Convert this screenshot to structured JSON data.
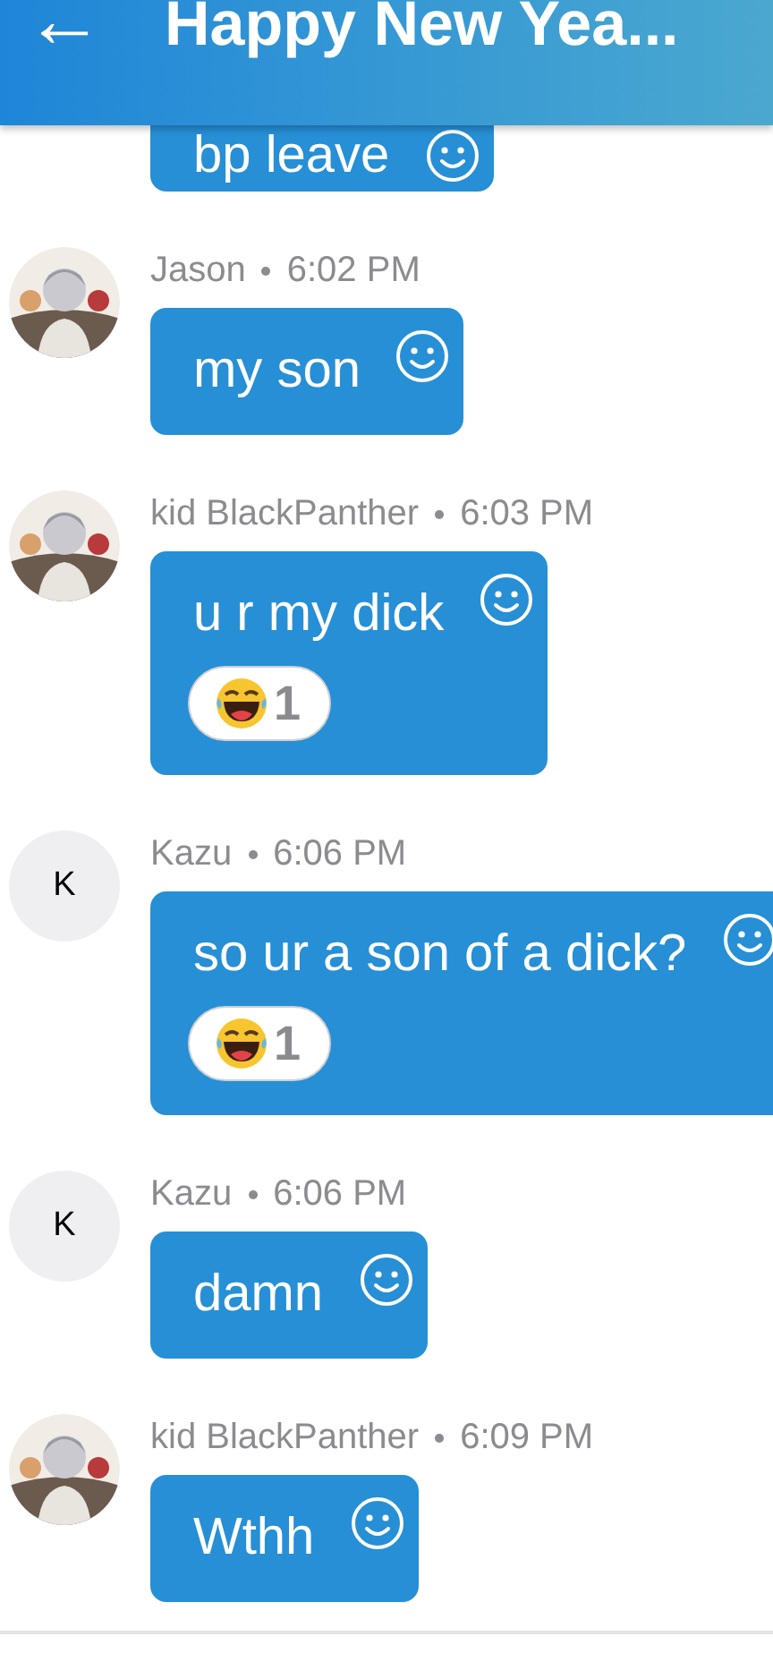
{
  "header": {
    "back": "←",
    "title": "Happy New Yea..."
  },
  "messages": [
    {
      "text": "bp leave"
    },
    {
      "sender": "Jason",
      "time": "6:02 PM",
      "text": "my son"
    },
    {
      "sender": "kid BlackPanther",
      "time": "6:03 PM",
      "text": "u r my dick",
      "reactions": [
        {
          "count": "1"
        }
      ]
    },
    {
      "avatar": {
        "kind": "initial",
        "initial": "K"
      },
      "sender": "Kazu",
      "time": "6:06 PM",
      "text": "so ur a son of a dick?",
      "reactions": [
        {
          "count": "1"
        }
      ]
    },
    {
      "avatar": {
        "kind": "initial",
        "initial": "K"
      },
      "sender": "Kazu",
      "time": "6:06 PM",
      "text": "damn"
    },
    {
      "sender": "kid BlackPanther",
      "time": "6:09 PM",
      "text": "Wthh"
    }
  ]
}
